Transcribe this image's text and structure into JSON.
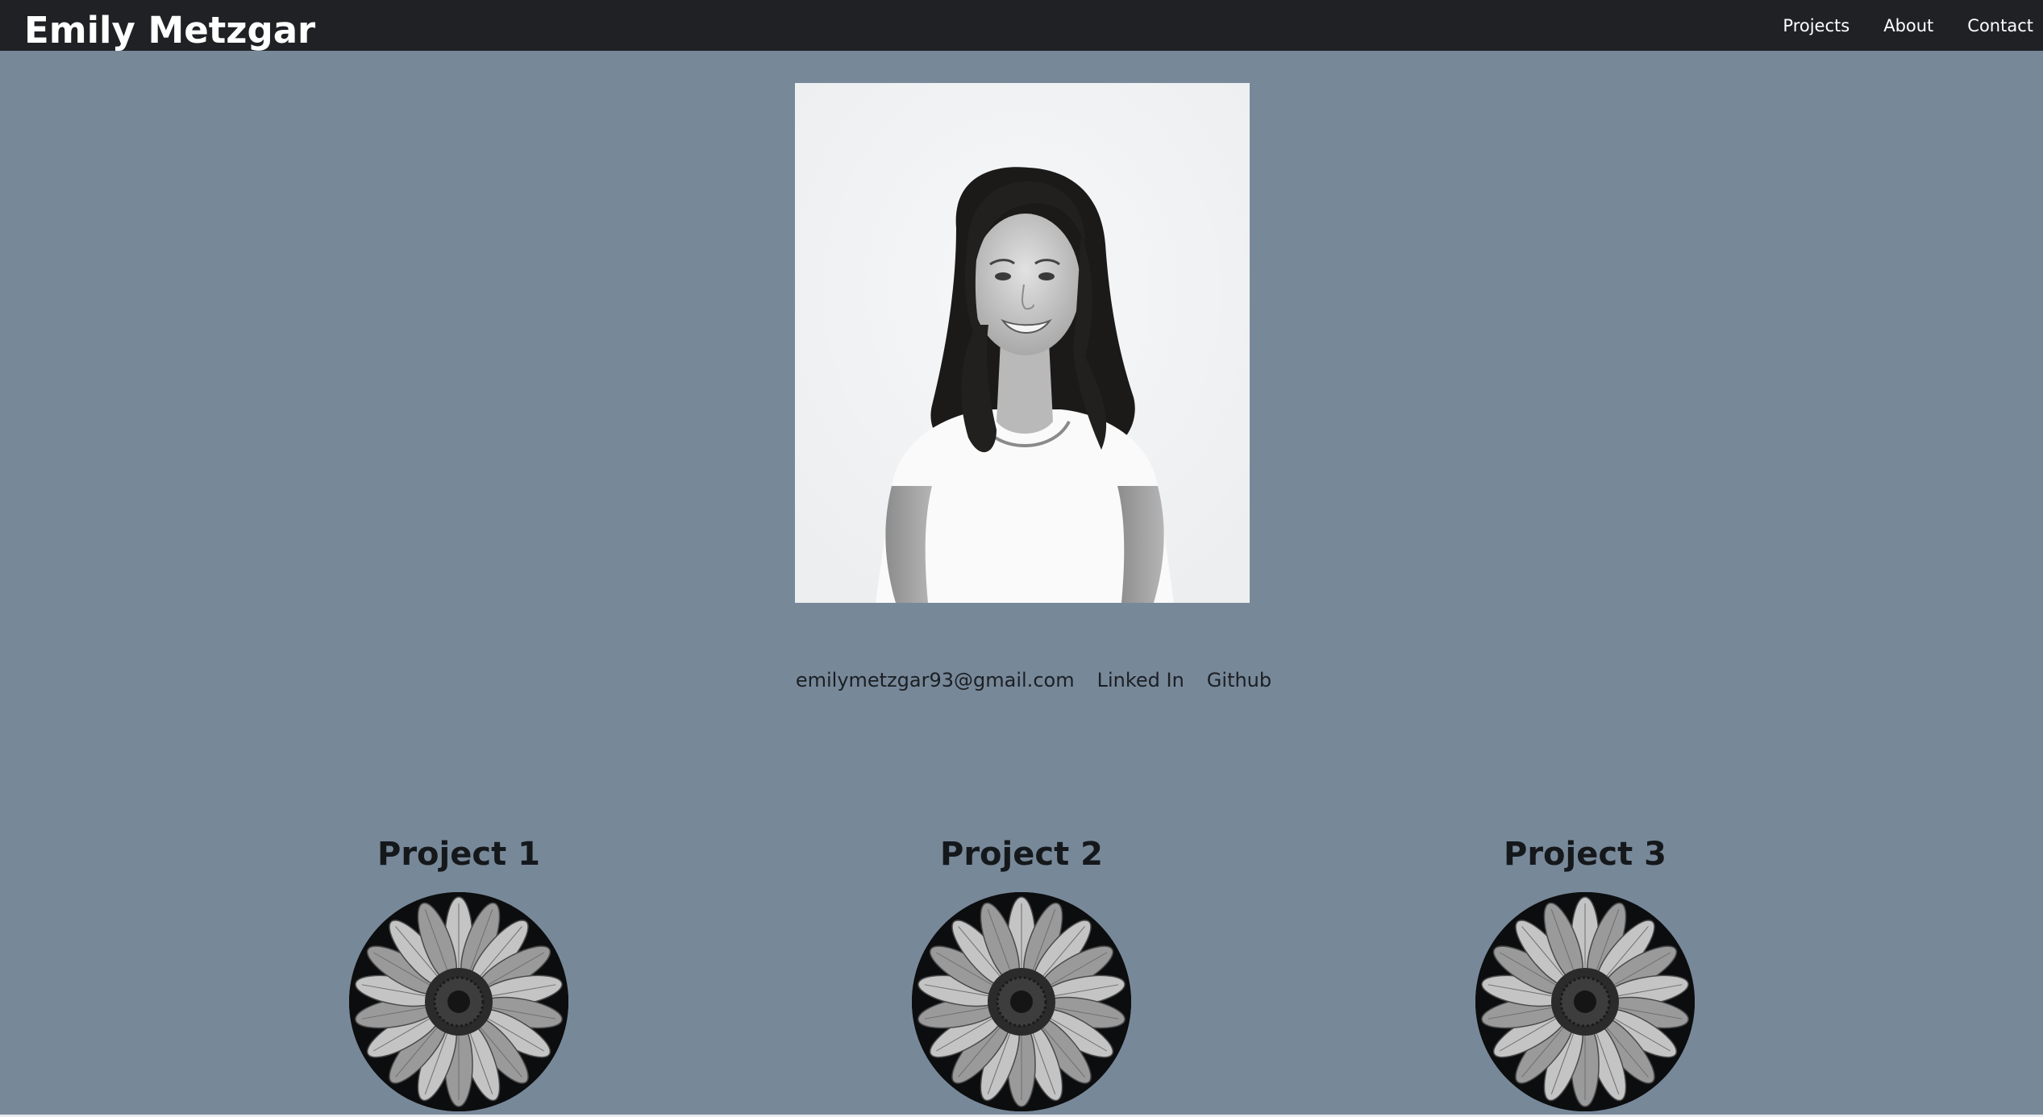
{
  "header": {
    "brand": "Emily Metzgar",
    "nav": [
      {
        "label": "Projects"
      },
      {
        "label": "About"
      },
      {
        "label": "Contact"
      }
    ]
  },
  "hero": {
    "portrait_icon": "portrait-photo"
  },
  "contact": {
    "email": "emilymetzgar93@gmail.com",
    "linkedin": "Linked In",
    "github": "Github"
  },
  "projects": [
    {
      "title": "Project 1",
      "thumbnail_icon": "daisy-flower"
    },
    {
      "title": "Project 2",
      "thumbnail_icon": "daisy-flower"
    },
    {
      "title": "Project 3",
      "thumbnail_icon": "daisy-flower"
    }
  ],
  "colors": {
    "page_background": "#778899",
    "navbar_background": "#1f2124",
    "text_dark": "#15181b",
    "text_light": "#ffffff"
  }
}
